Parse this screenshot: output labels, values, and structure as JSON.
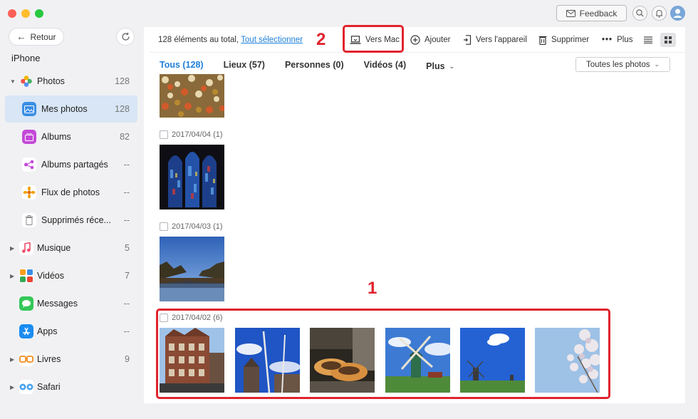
{
  "titlebar": {
    "feedback_label": "Feedback"
  },
  "sidebar": {
    "back_label": "Retour",
    "device_name": "iPhone",
    "items": [
      {
        "label": "Photos",
        "count": "128"
      },
      {
        "label": "Mes photos",
        "count": "128"
      },
      {
        "label": "Albums",
        "count": "82"
      },
      {
        "label": "Albums partagés",
        "count": "--"
      },
      {
        "label": "Flux de photos",
        "count": "--"
      },
      {
        "label": "Supprimés réce...",
        "count": "--"
      },
      {
        "label": "Musique",
        "count": "5"
      },
      {
        "label": "Vidéos",
        "count": "7"
      },
      {
        "label": "Messages",
        "count": "--"
      },
      {
        "label": "Apps",
        "count": "--"
      },
      {
        "label": "Livres",
        "count": "9"
      },
      {
        "label": "Safari",
        "count": ""
      }
    ]
  },
  "toolbar": {
    "total_text": "128 éléments au total,",
    "select_all": "Tout sélectionner",
    "to_mac": "Vers Mac",
    "add": "Ajouter",
    "to_device": "Vers l'appareil",
    "delete": "Supprimer",
    "more": "Plus"
  },
  "tabs": [
    {
      "label": "Tous (128)"
    },
    {
      "label": "Lieux (57)"
    },
    {
      "label": "Personnes (0)"
    },
    {
      "label": "Vidéos (4)"
    },
    {
      "label": "Plus"
    }
  ],
  "filter_label": "Toutes les photos",
  "groups": [
    {
      "date": "2017/04/04 (1)"
    },
    {
      "date": "2017/04/03 (1)"
    },
    {
      "date": "2017/04/02 (6)"
    }
  ],
  "annotations": {
    "step1": "1",
    "step2": "2"
  },
  "colors": {
    "accent": "#1e7fd8",
    "annotation": "#e0232d",
    "active_nav": "#d8e6f5"
  }
}
